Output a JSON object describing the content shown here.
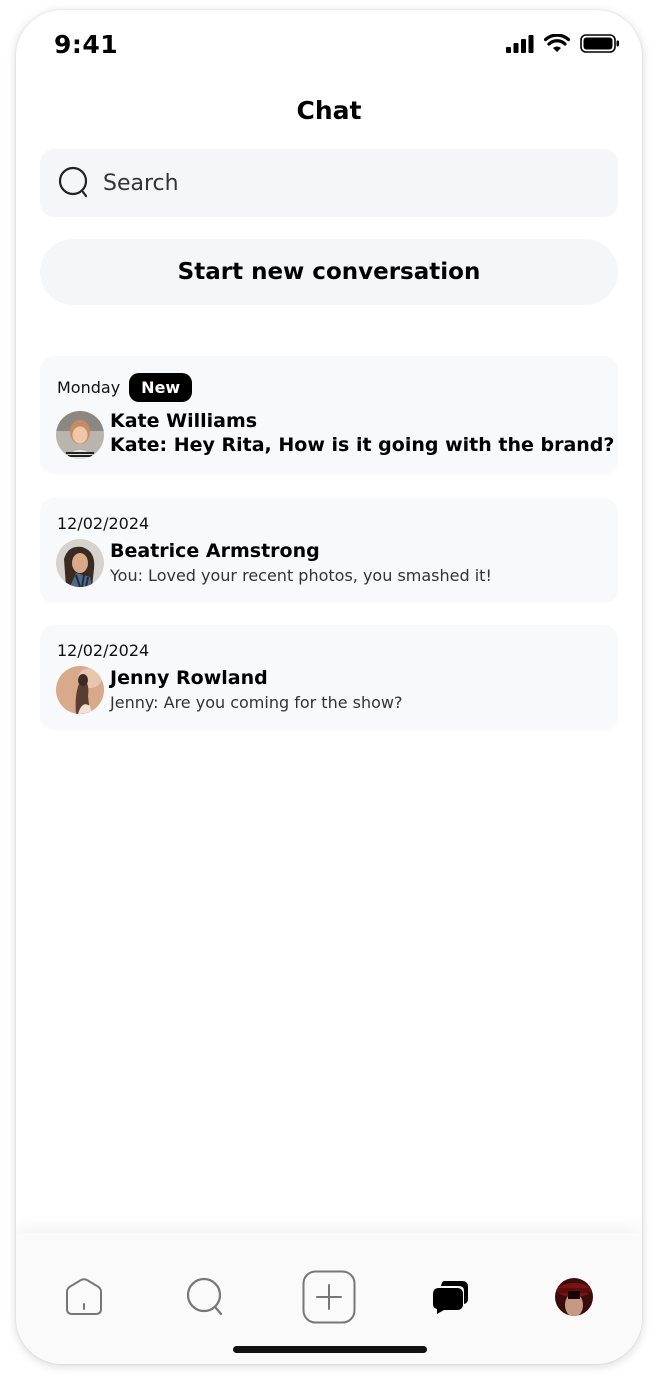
{
  "status_bar": {
    "time": "9:41",
    "icons": [
      "cellular-signal-icon",
      "wifi-icon",
      "battery-icon"
    ]
  },
  "header": {
    "title": "Chat"
  },
  "search": {
    "placeholder": "Search",
    "icon": "search-icon"
  },
  "actions": {
    "new_conversation_label": "Start new conversation"
  },
  "conversations": [
    {
      "date": "Monday",
      "badge": "New",
      "name": "Kate Williams",
      "preview": "Kate: Hey Rita, How is it going with the brand?",
      "unread": true
    },
    {
      "date": "12/02/2024",
      "name": "Beatrice Armstrong",
      "preview": "You: Loved your recent photos, you smashed it!",
      "unread": false
    },
    {
      "date": "12/02/2024",
      "name": "Jenny Rowland",
      "preview": "Jenny: Are you coming for the show?",
      "unread": false
    }
  ],
  "tab_bar": {
    "tabs": [
      {
        "icon": "home-icon",
        "active": false
      },
      {
        "icon": "search-icon",
        "active": false
      },
      {
        "icon": "add-icon",
        "active": false
      },
      {
        "icon": "chat-bubbles-icon",
        "active": true
      },
      {
        "icon": "profile-avatar",
        "active": false
      }
    ]
  },
  "colors": {
    "background": "#ffffff",
    "surface": "#f5f6f7",
    "text": "#000000",
    "secondary_text": "#333333",
    "badge_bg": "#000000",
    "badge_text": "#ffffff",
    "icon_inactive": "#777777"
  }
}
